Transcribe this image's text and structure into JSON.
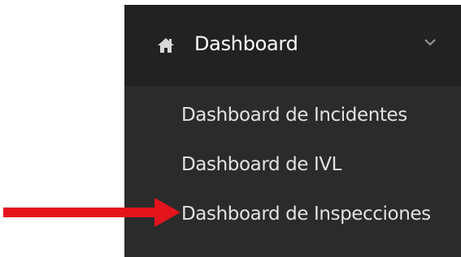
{
  "menu": {
    "header_label": "Dashboard",
    "header_icon": "home-icon",
    "expand_icon": "chevron-down-icon",
    "items": [
      {
        "label": "Dashboard de Incidentes"
      },
      {
        "label": "Dashboard de IVL"
      },
      {
        "label": "Dashboard de Inspecciones"
      }
    ]
  },
  "annotation": {
    "icon": "red-arrow-icon",
    "color": "#e3141c"
  },
  "colors": {
    "sidebar_bg": "#2b2b2b",
    "header_bg": "#222222",
    "text": "#e2e2e2"
  }
}
